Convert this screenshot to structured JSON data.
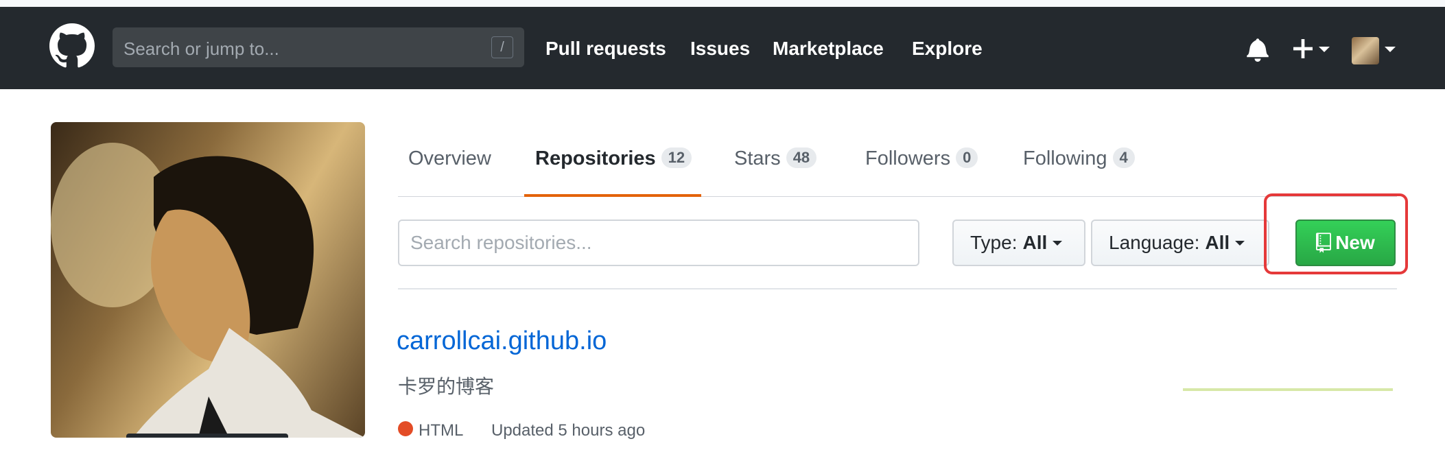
{
  "header": {
    "search_placeholder": "Search or jump to...",
    "search_shortcut": "/",
    "nav": [
      "Pull requests",
      "Issues",
      "Marketplace",
      "Explore"
    ]
  },
  "profile_tabs": [
    {
      "label": "Overview",
      "count": null
    },
    {
      "label": "Repositories",
      "count": "12",
      "selected": true
    },
    {
      "label": "Stars",
      "count": "48"
    },
    {
      "label": "Followers",
      "count": "0"
    },
    {
      "label": "Following",
      "count": "4"
    }
  ],
  "filters": {
    "search_placeholder": "Search repositories...",
    "type_label": "Type:",
    "type_value": "All",
    "language_label": "Language:",
    "language_value": "All",
    "new_button": "New"
  },
  "repos": [
    {
      "name": "carrollcai.github.io",
      "description": "卡罗的博客",
      "language": "HTML",
      "language_color": "#e34c26",
      "updated": "Updated 5 hours ago"
    }
  ],
  "colors": {
    "header_bg": "#24292e",
    "accent_tab": "#e36209",
    "link": "#0366d6",
    "new_button": "#28a745",
    "highlight": "#e5393a"
  }
}
